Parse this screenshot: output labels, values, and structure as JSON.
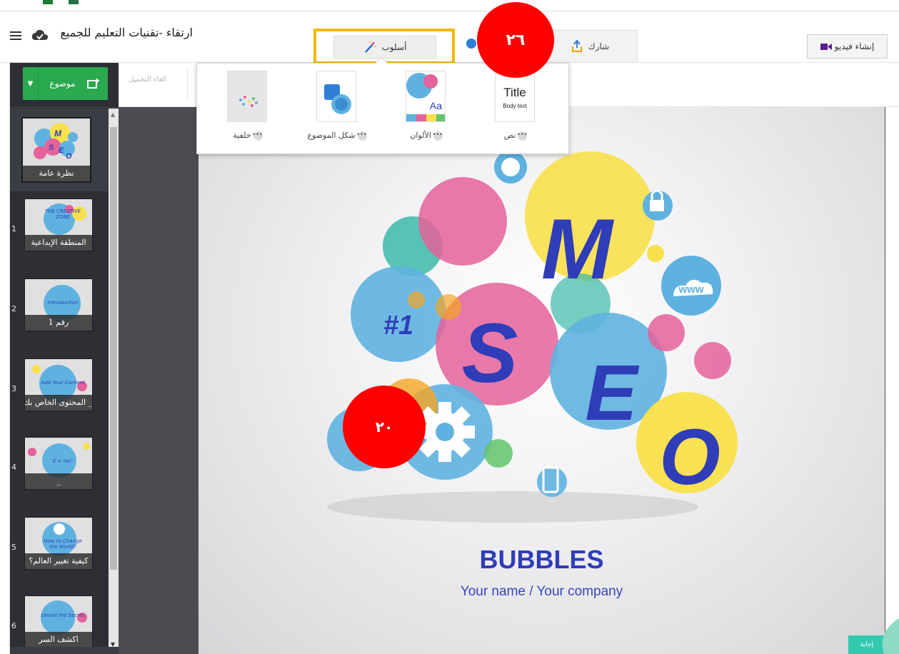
{
  "header": {
    "presentation_title": "ارتقاء -تقنيات التعليم للجميع",
    "style_button_label": "أسلوب",
    "share_button_label": "شارك",
    "create_video_label": "إنشاء فيديو"
  },
  "annotations": {
    "badge_style": "٢٦",
    "badge_slide": "٢٠"
  },
  "sidebar": {
    "topic_button_label": "موضوع",
    "overview_label": "نظرة عامة",
    "slides": [
      {
        "number": "1",
        "caption": "المنطقة الإبداعية",
        "thumb_text": "THE CREATIVE ZONE"
      },
      {
        "number": "2",
        "caption": "رقم 1",
        "thumb_text": "Introduction"
      },
      {
        "number": "3",
        "caption": "_ المحتوى الخاص بك",
        "thumb_text": "Add Your Content"
      },
      {
        "number": "4",
        "caption": "_",
        "thumb_text": "E = mc²"
      },
      {
        "number": "5",
        "caption": "كيفية تغيير العالم؟",
        "thumb_text": "How to Change the World?"
      },
      {
        "number": "6",
        "caption": "اكشف السر",
        "thumb_text": "Unveil the Secret"
      }
    ]
  },
  "subbar": {
    "undo_label": "الغاء التحميل"
  },
  "style_popover": {
    "options": [
      {
        "label": "نص",
        "tile_title": "Title",
        "tile_body": "Body text"
      },
      {
        "label": "الألوان",
        "tile_text": "Aa"
      },
      {
        "label": "شكل الموضوع"
      },
      {
        "label": "خلفية"
      }
    ]
  },
  "slide": {
    "title": "BUBBLES",
    "subtitle": "Your name / Your company",
    "bubble_letters": [
      "M",
      "S",
      "E",
      "O"
    ],
    "bubble_text_hash": "#1",
    "bubble_text_www": "www"
  },
  "help_tab_label": "إجابة",
  "colors": {
    "accent_green": "#2aa94e",
    "highlight_yellow": "#f5b800",
    "badge_red": "#ff0000",
    "bubble_blue": "#5fb2e0",
    "bubble_pink": "#e5629a",
    "bubble_yellow": "#f8e04b",
    "text_blue": "#2f3db8"
  }
}
